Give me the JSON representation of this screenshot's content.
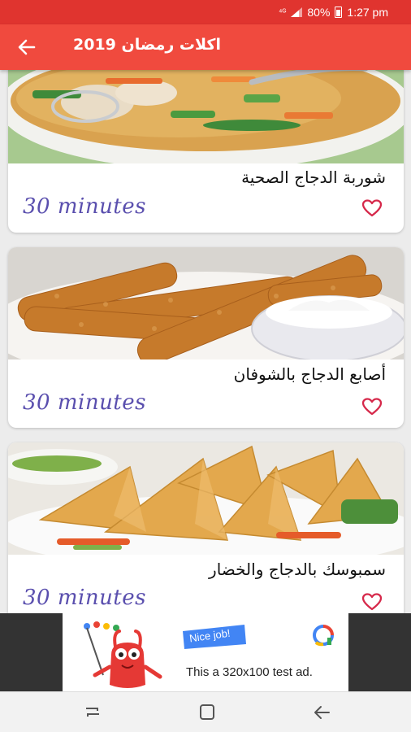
{
  "status_bar": {
    "battery_percent": "80%",
    "time": "1:27 pm",
    "icons": [
      "data-saver-icon",
      "signal-icon",
      "battery-icon"
    ]
  },
  "app_bar": {
    "title": "اكلات رمضان 2019",
    "back_icon": "arrow-left-icon"
  },
  "recipes": [
    {
      "title": "شوربة الدجاج الصحية",
      "time": "30 minutes",
      "image": "chicken-soup-image",
      "favorite_icon": "heart-outline-icon"
    },
    {
      "title": "أصابع الدجاج بالشوفان",
      "time": "30 minutes",
      "image": "chicken-fingers-image",
      "favorite_icon": "heart-outline-icon"
    },
    {
      "title": "سمبوسك بالدجاج والخضار",
      "time": "30 minutes",
      "image": "samosa-image",
      "favorite_icon": "heart-outline-icon"
    }
  ],
  "ad": {
    "badge_text": "Nice job!",
    "text": "This a 320x100 test ad."
  },
  "nav_bar": {
    "icons": [
      "recent-apps-icon",
      "home-icon",
      "back-icon"
    ]
  },
  "colors": {
    "status_bar": "#e0342f",
    "app_bar": "#f04a3e",
    "time_text": "#5a4fae",
    "heart": "#d6284a"
  }
}
